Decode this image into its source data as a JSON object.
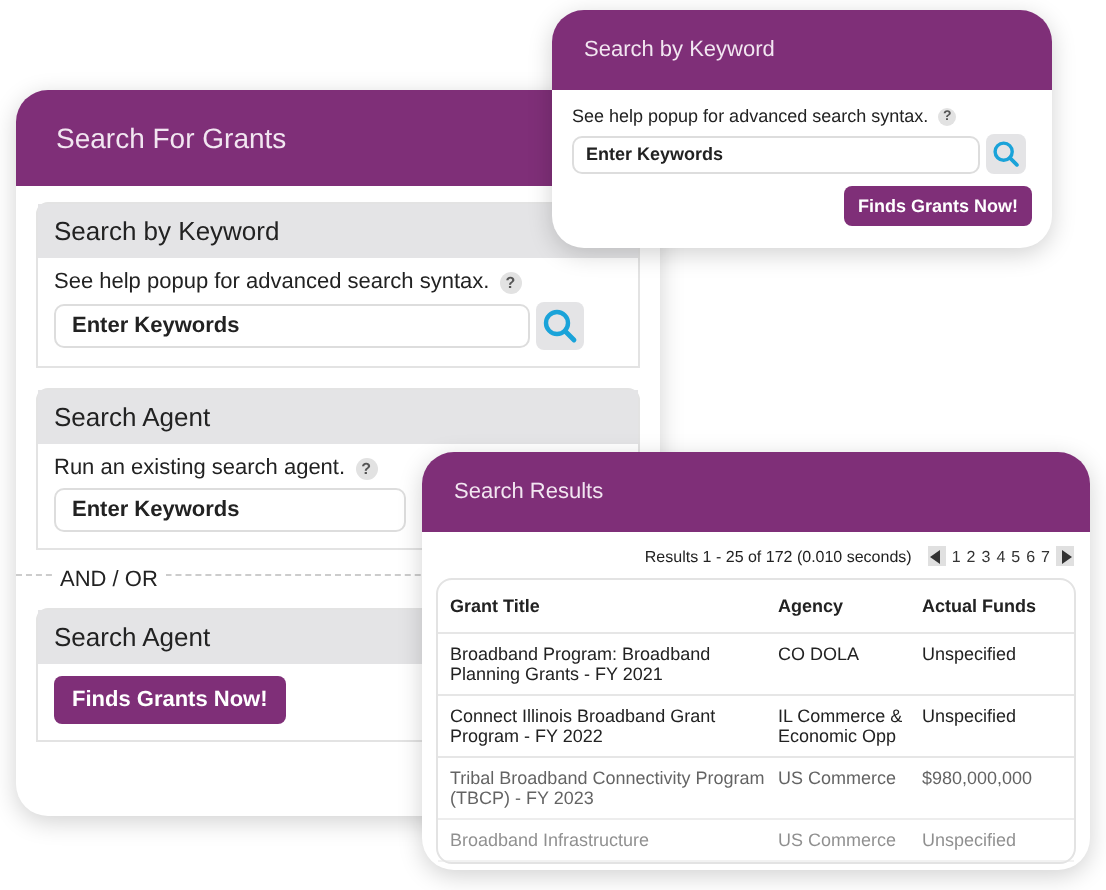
{
  "main_panel": {
    "title": "Search For Grants",
    "sections": [
      {
        "kind": "keyword",
        "title": "Search by Keyword",
        "hint": "See help popup for advanced search syntax.",
        "help": "?",
        "field_placeholder": "Enter Keywords"
      },
      {
        "kind": "agent",
        "title": "Search Agent",
        "hint": "Run an existing search agent.",
        "help": "?",
        "field_placeholder": "Enter Keywords"
      },
      {
        "kind": "separator",
        "label": "AND / OR"
      },
      {
        "kind": "action",
        "title": "Search Agent",
        "button": "Finds Grants Now!"
      }
    ]
  },
  "keyword_popup": {
    "title": "Search by Keyword",
    "hint": "See help popup for advanced search syntax.",
    "help": "?",
    "field_placeholder": "Enter Keywords",
    "button": "Finds Grants Now!"
  },
  "results_panel": {
    "title": "Search Results",
    "summary": "Results 1 - 25 of 172 (0.010 seconds)",
    "pages": [
      "1",
      "2",
      "3",
      "4",
      "5",
      "6",
      "7"
    ],
    "columns": [
      "Grant Title",
      "Agency",
      "Actual Funds"
    ],
    "rows": [
      {
        "kind": "normal",
        "cells": [
          "Broadband Program: Broadband Planning Grants - FY 2021",
          "CO DOLA",
          "Unspecified"
        ]
      },
      {
        "kind": "normal",
        "cells": [
          "Connect Illinois Broadband Grant Program - FY 2022",
          "IL Commerce & Economic Opp",
          "Unspecified"
        ]
      },
      {
        "kind": "dim",
        "cells": [
          "Tribal Broadband Connectivity Program (TBCP) - FY 2023",
          "US Commerce",
          "$980,000,000"
        ]
      },
      {
        "kind": "faint",
        "cells": [
          "Broadband Infrastructure",
          "US Commerce",
          "Unspecified"
        ]
      }
    ]
  }
}
